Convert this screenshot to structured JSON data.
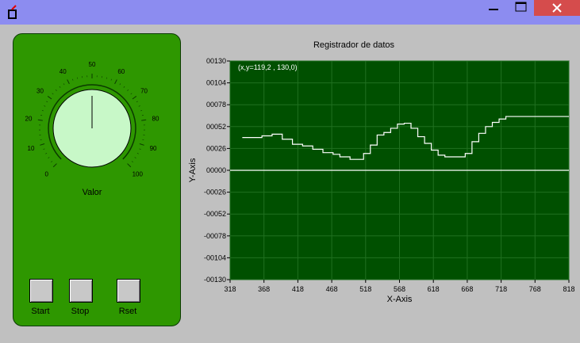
{
  "window": {
    "title": "",
    "minimize_icon": "minimize-icon",
    "maximize_icon": "maximize-icon",
    "close_icon": "close-icon",
    "colors": {
      "titlebar": "#8c8cf0",
      "close": "#d54c4c",
      "client": "#c0c0c0"
    }
  },
  "knob": {
    "label": "Valor",
    "value": 50,
    "min": 0,
    "max": 100,
    "ticks": [
      "0",
      "10",
      "20",
      "30",
      "40",
      "50",
      "60",
      "70",
      "80",
      "90",
      "100"
    ],
    "colors": {
      "panel": "#2e9700",
      "dial": "#c8f8c8"
    }
  },
  "buttons": [
    {
      "label": "Start"
    },
    {
      "label": "Stop"
    },
    {
      "label": "Rset"
    }
  ],
  "chart_data": {
    "type": "line",
    "title": "Registrador de datos",
    "xlabel": "X-Axis",
    "ylabel": "Y-Axis",
    "xlim": [
      318,
      818
    ],
    "ylim": [
      -130,
      130
    ],
    "grid": true,
    "x_ticks": [
      "318",
      "368",
      "418",
      "468",
      "518",
      "568",
      "618",
      "668",
      "718",
      "768",
      "818"
    ],
    "y_ticks": [
      "00130",
      "00104",
      "00078",
      "00052",
      "00026",
      "00000",
      "-00026",
      "-00052",
      "-00078",
      "-00104",
      "-00130"
    ],
    "cursor_readout": "(x,y=119,2 , 130,0)",
    "colors": {
      "plot_bg": "#005000",
      "grid": "#207020",
      "line": "#ffffff"
    },
    "series": [
      {
        "x": [
          336,
          350,
          365,
          380,
          395,
          410,
          425,
          440,
          455,
          470,
          480,
          495,
          505,
          515,
          525,
          535,
          545,
          555,
          565,
          575,
          585,
          595,
          605,
          615,
          625,
          635,
          645,
          655,
          665,
          675,
          685,
          695,
          705,
          715,
          725,
          735,
          750,
          770,
          790,
          818
        ],
        "y": [
          39,
          39,
          41,
          43,
          37,
          31,
          29,
          25,
          21,
          19,
          16,
          13,
          13,
          20,
          30,
          42,
          45,
          50,
          55,
          56,
          50,
          40,
          32,
          24,
          18,
          16,
          16,
          16,
          20,
          34,
          44,
          52,
          57,
          61,
          64,
          64,
          64,
          64,
          64,
          64
        ]
      },
      {
        "x": [
          318,
          818
        ],
        "y": [
          0,
          0
        ]
      }
    ]
  }
}
